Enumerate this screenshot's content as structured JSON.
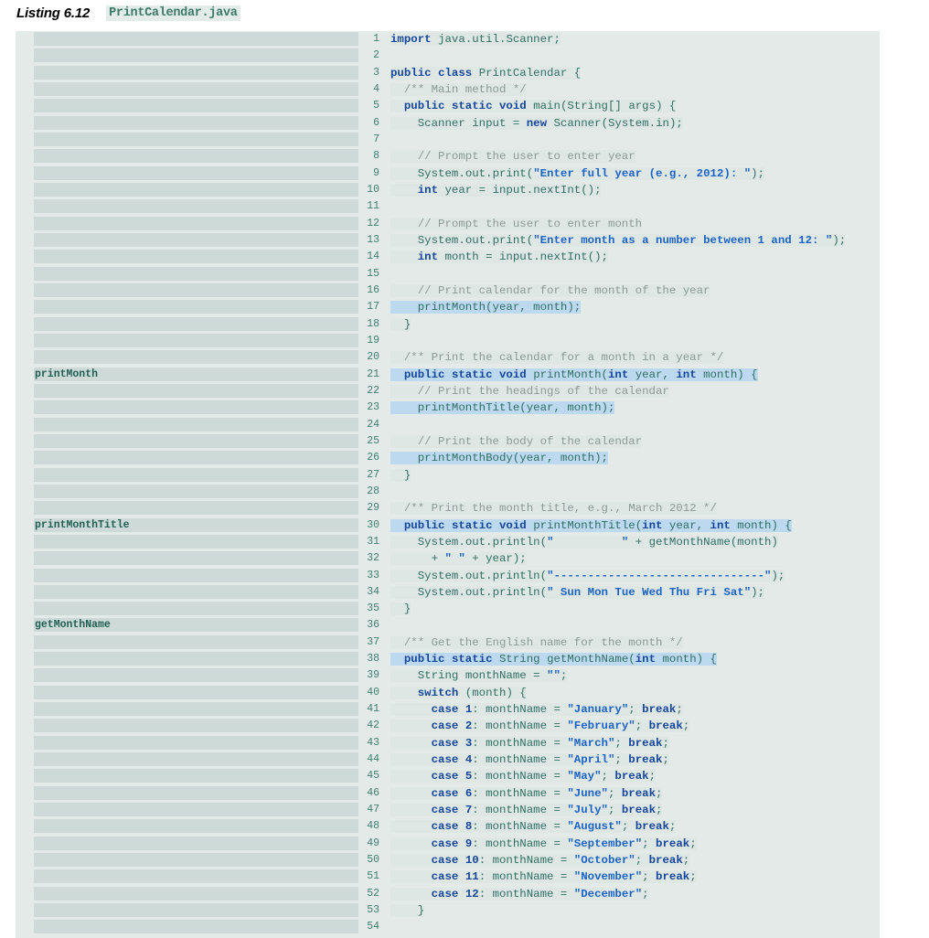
{
  "header": {
    "listing_number": "Listing 6.12",
    "filename": "PrintCalendar.java"
  },
  "colors": {
    "panel_background": "#e3eae7",
    "stripe": "#cedad7",
    "line_number": "#3f7f71",
    "keyword": "#14469b",
    "string": "#1b63c4",
    "comment": "#8a9a96",
    "identifier": "#2f6f62",
    "highlight_blue": "#bcd9f0",
    "highlight_plain": "#dfe7e4",
    "filename_text": "#3c7a68"
  },
  "code": {
    "language": "java",
    "first_line": 1,
    "last_line": 54,
    "margin_labels": [
      {
        "line": 21,
        "text": "printMonth"
      },
      {
        "line": 30,
        "text": "printMonthTitle"
      },
      {
        "line": 36,
        "text": "getMonthName"
      }
    ],
    "lines": [
      {
        "n": 1,
        "hl": "plain",
        "text": "import java.util.Scanner;"
      },
      {
        "n": 2,
        "hl": "none",
        "text": ""
      },
      {
        "n": 3,
        "hl": "plain",
        "text": "public class PrintCalendar {"
      },
      {
        "n": 4,
        "hl": "plain",
        "text": "  /** Main method */"
      },
      {
        "n": 5,
        "hl": "plain",
        "text": "  public static void main(String[] args) {"
      },
      {
        "n": 6,
        "hl": "plain",
        "text": "    Scanner input = new Scanner(System.in);"
      },
      {
        "n": 7,
        "hl": "none",
        "text": ""
      },
      {
        "n": 8,
        "hl": "plain",
        "text": "    // Prompt the user to enter year"
      },
      {
        "n": 9,
        "hl": "plain",
        "text": "    System.out.print(\"Enter full year (e.g., 2012): \");"
      },
      {
        "n": 10,
        "hl": "plain",
        "text": "    int year = input.nextInt();"
      },
      {
        "n": 11,
        "hl": "none",
        "text": ""
      },
      {
        "n": 12,
        "hl": "plain",
        "text": "    // Prompt the user to enter month"
      },
      {
        "n": 13,
        "hl": "plain",
        "text": "    System.out.print(\"Enter month as a number between 1 and 12: \");"
      },
      {
        "n": 14,
        "hl": "plain",
        "text": "    int month = input.nextInt();"
      },
      {
        "n": 15,
        "hl": "none",
        "text": ""
      },
      {
        "n": 16,
        "hl": "plain",
        "text": "    // Print calendar for the month of the year"
      },
      {
        "n": 17,
        "hl": "blue",
        "text": "    printMonth(year, month);"
      },
      {
        "n": 18,
        "hl": "plain",
        "text": "  }"
      },
      {
        "n": 19,
        "hl": "none",
        "text": ""
      },
      {
        "n": 20,
        "hl": "plain",
        "text": "  /** Print the calendar for a month in a year */"
      },
      {
        "n": 21,
        "hl": "blue",
        "text": "  public static void printMonth(int year, int month) {"
      },
      {
        "n": 22,
        "hl": "plain",
        "text": "    // Print the headings of the calendar"
      },
      {
        "n": 23,
        "hl": "blue",
        "text": "    printMonthTitle(year, month);"
      },
      {
        "n": 24,
        "hl": "none",
        "text": ""
      },
      {
        "n": 25,
        "hl": "plain",
        "text": "    // Print the body of the calendar"
      },
      {
        "n": 26,
        "hl": "blue",
        "text": "    printMonthBody(year, month);"
      },
      {
        "n": 27,
        "hl": "plain",
        "text": "  }"
      },
      {
        "n": 28,
        "hl": "none",
        "text": ""
      },
      {
        "n": 29,
        "hl": "plain",
        "text": "  /** Print the month title, e.g., March 2012 */"
      },
      {
        "n": 30,
        "hl": "blue",
        "text": "  public static void printMonthTitle(int year, int month) {"
      },
      {
        "n": 31,
        "hl": "plain",
        "text": "    System.out.println(\"          \" + getMonthName(month)"
      },
      {
        "n": 32,
        "hl": "plain",
        "text": "      + \" \" + year);"
      },
      {
        "n": 33,
        "hl": "plain",
        "text": "    System.out.println(\"-------------------------------\");"
      },
      {
        "n": 34,
        "hl": "plain",
        "text": "    System.out.println(\" Sun Mon Tue Wed Thu Fri Sat\");"
      },
      {
        "n": 35,
        "hl": "plain",
        "text": "  }"
      },
      {
        "n": 36,
        "hl": "none",
        "text": ""
      },
      {
        "n": 37,
        "hl": "plain",
        "text": "  /** Get the English name for the month */"
      },
      {
        "n": 38,
        "hl": "blue",
        "text": "  public static String getMonthName(int month) {"
      },
      {
        "n": 39,
        "hl": "plain",
        "text": "    String monthName = \"\";"
      },
      {
        "n": 40,
        "hl": "plain",
        "text": "    switch (month) {"
      },
      {
        "n": 41,
        "hl": "plain",
        "text": "      case 1: monthName = \"January\"; break;"
      },
      {
        "n": 42,
        "hl": "plain",
        "text": "      case 2: monthName = \"February\"; break;"
      },
      {
        "n": 43,
        "hl": "plain",
        "text": "      case 3: monthName = \"March\"; break;"
      },
      {
        "n": 44,
        "hl": "plain",
        "text": "      case 4: monthName = \"April\"; break;"
      },
      {
        "n": 45,
        "hl": "plain",
        "text": "      case 5: monthName = \"May\"; break;"
      },
      {
        "n": 46,
        "hl": "plain",
        "text": "      case 6: monthName = \"June\"; break;"
      },
      {
        "n": 47,
        "hl": "plain",
        "text": "      case 7: monthName = \"July\"; break;"
      },
      {
        "n": 48,
        "hl": "plain",
        "text": "      case 8: monthName = \"August\"; break;"
      },
      {
        "n": 49,
        "hl": "plain",
        "text": "      case 9: monthName = \"September\"; break;"
      },
      {
        "n": 50,
        "hl": "plain",
        "text": "      case 10: monthName = \"October\"; break;"
      },
      {
        "n": 51,
        "hl": "plain",
        "text": "      case 11: monthName = \"November\"; break;"
      },
      {
        "n": 52,
        "hl": "plain",
        "text": "      case 12: monthName = \"December\";"
      },
      {
        "n": 53,
        "hl": "plain",
        "text": "    }"
      },
      {
        "n": 54,
        "hl": "none",
        "text": ""
      }
    ]
  }
}
